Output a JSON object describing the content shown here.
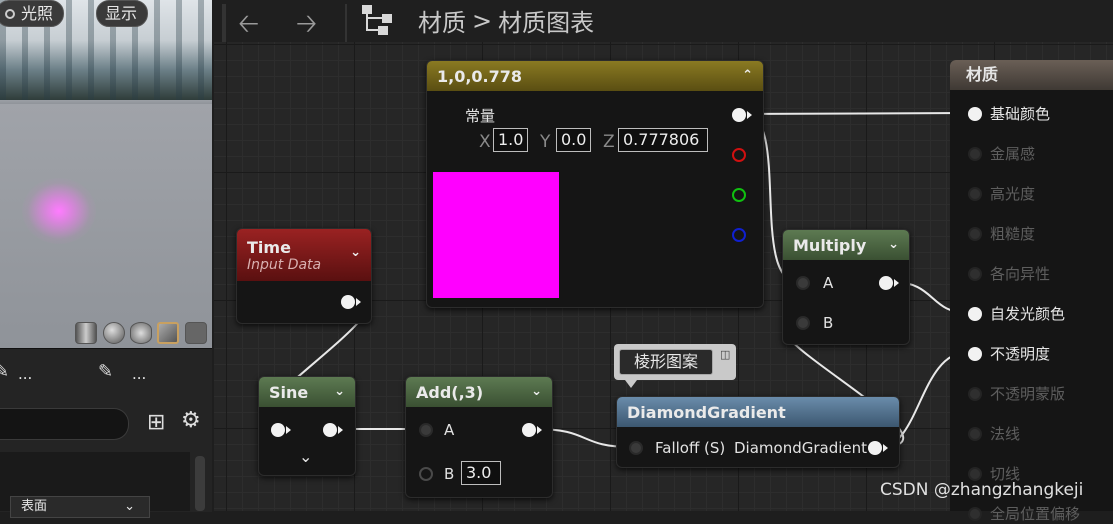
{
  "viewport": {
    "lighting_button": "光照",
    "show_button": "显示"
  },
  "left_toolbar": {
    "ellipsis_1": "...",
    "ellipsis_2": "..."
  },
  "details": {
    "surface_dropdown": "表面"
  },
  "header": {
    "breadcrumb_root": "材质",
    "breadcrumb_sep": ">",
    "breadcrumb_current": "材质图表"
  },
  "nodes": {
    "constant3": {
      "title": "1,0,0.778",
      "label": "常量",
      "x_label": "X",
      "x_value": "1.0",
      "y_label": "Y",
      "y_value": "0.0",
      "z_label": "Z",
      "z_value": "0.777806",
      "swatch_color": "#ff00ff"
    },
    "time": {
      "title": "Time",
      "subtitle": "Input Data"
    },
    "sine": {
      "title": "Sine"
    },
    "add": {
      "title": "Add(,3)",
      "pin_a": "A",
      "pin_b": "B",
      "b_value": "3.0"
    },
    "multiply": {
      "title": "Multiply",
      "pin_a": "A",
      "pin_b": "B"
    },
    "diamond": {
      "title": "DiamondGradient",
      "input": "Falloff (S)",
      "output": "DiamondGradient",
      "comment": "棱形图案"
    }
  },
  "material": {
    "title": "材质",
    "inputs": [
      {
        "label": "基础颜色",
        "active": true
      },
      {
        "label": "金属感",
        "active": false
      },
      {
        "label": "高光度",
        "active": false
      },
      {
        "label": "粗糙度",
        "active": false
      },
      {
        "label": "各向异性",
        "active": false
      },
      {
        "label": "自发光颜色",
        "active": true
      },
      {
        "label": "不透明度",
        "active": true
      },
      {
        "label": "不透明蒙版",
        "active": false
      },
      {
        "label": "法线",
        "active": false
      },
      {
        "label": "切线",
        "active": false
      },
      {
        "label": "全局位置偏移",
        "active": false
      }
    ]
  },
  "watermark": "CSDN @zhangzhangkeji",
  "colors": {
    "constant_header": "#7a6a1a",
    "time_header": "#8a1c1c",
    "math_header": "#4f6a45",
    "diamond_header": "#4e6f8c",
    "material_header": "#5a5048"
  }
}
